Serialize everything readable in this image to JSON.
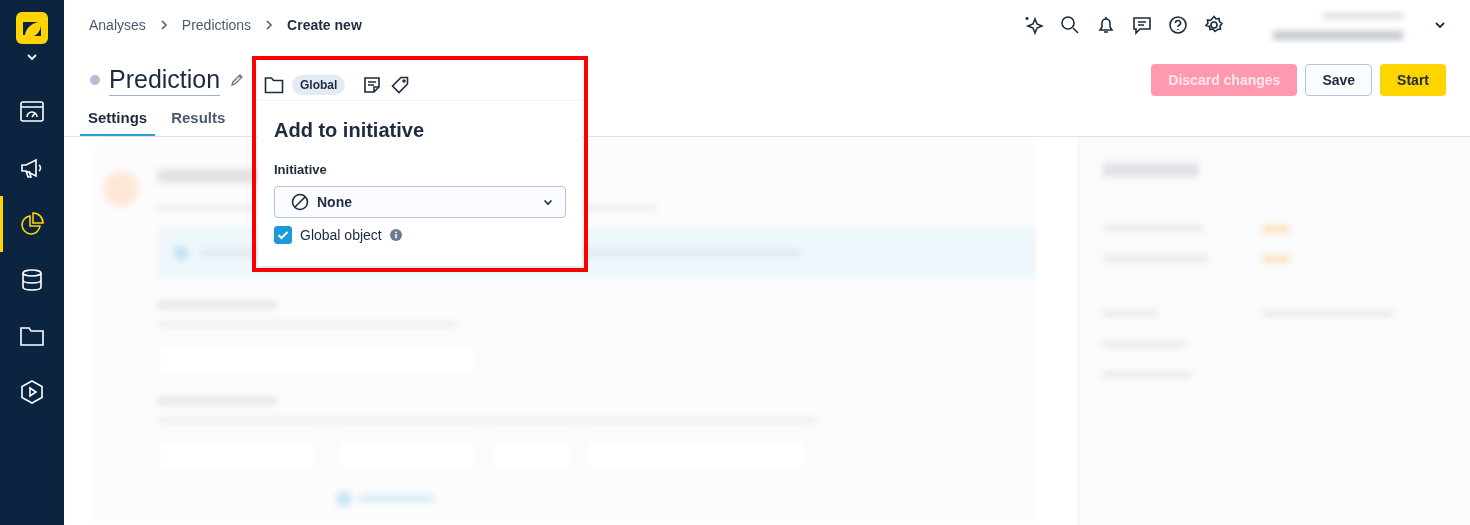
{
  "sidebar": {
    "items": [
      {
        "kind": "dashboard",
        "selected": false
      },
      {
        "kind": "megaphone",
        "selected": false
      },
      {
        "kind": "pie",
        "selected": true
      },
      {
        "kind": "database",
        "selected": false
      },
      {
        "kind": "folder",
        "selected": false
      },
      {
        "kind": "play",
        "selected": false
      }
    ]
  },
  "breadcrumbs": [
    {
      "label": "Analyses",
      "current": false
    },
    {
      "label": "Predictions",
      "current": false
    },
    {
      "label": "Create new",
      "current": true
    }
  ],
  "title": "Prediction",
  "tabs": [
    {
      "label": "Settings",
      "selected": true
    },
    {
      "label": "Results",
      "selected": false
    }
  ],
  "buttons": [
    {
      "label": "Discard changes",
      "kind": "danger",
      "disabled": true
    },
    {
      "label": "Save",
      "kind": "secondary",
      "disabled": false
    },
    {
      "label": "Start",
      "kind": "primary",
      "disabled": false
    }
  ],
  "popover": {
    "chip": "Global",
    "heading": "Add to initiative",
    "field_label": "Initiative",
    "select_value": "None",
    "checkbox": {
      "label": "Global object",
      "checked": true
    }
  }
}
